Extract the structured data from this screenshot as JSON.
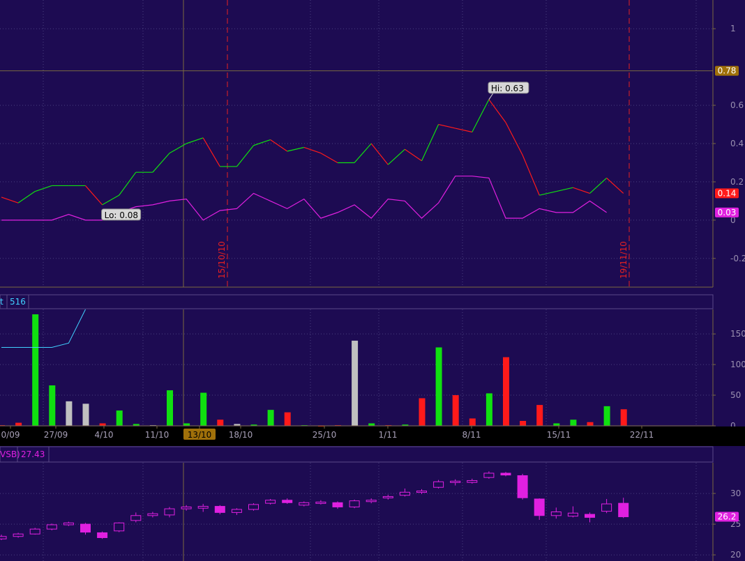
{
  "colors": {
    "background": "#1d0b52",
    "grid": "#4a4080",
    "axis": "#7a6a40",
    "up": "#10e010",
    "down": "#ff1a1a",
    "neutral": "#c0c0c0",
    "oscillator": "#e020e0",
    "cyan": "#40d0ff",
    "marker": "#e82020",
    "crosshair_badge": "#a0700a"
  },
  "chart_data": [
    {
      "type": "line",
      "panel": "top",
      "ylim": [
        -0.35,
        1.15
      ],
      "yticks": [
        "1",
        "0.6",
        "0.4",
        "0.2",
        "0",
        "-0.2"
      ],
      "ytick_values": [
        1,
        0.6,
        0.4,
        0.2,
        0,
        -0.2
      ],
      "crosshair": {
        "value": 0.78,
        "label": "0.78"
      },
      "series": [
        {
          "color": "red_green",
          "values": [
            0.12,
            0.09,
            0.15,
            0.18,
            0.18,
            0.18,
            0.08,
            0.13,
            0.25,
            0.25,
            0.35,
            0.4,
            0.43,
            0.28,
            0.28,
            0.39,
            0.42,
            0.36,
            0.38,
            0.35,
            0.3,
            0.3,
            0.4,
            0.29,
            0.37,
            0.31,
            0.5,
            0.48,
            0.46,
            0.63,
            0.51,
            0.34,
            0.13,
            0.15,
            0.17,
            0.14,
            0.22,
            0.14
          ],
          "last_label": "0.14"
        },
        {
          "color": "magenta",
          "values": [
            0.0,
            0.0,
            0.0,
            0.0,
            0.03,
            0.0,
            0.0,
            0.04,
            0.07,
            0.08,
            0.1,
            0.11,
            0.0,
            0.05,
            0.06,
            0.14,
            0.1,
            0.06,
            0.11,
            0.01,
            0.04,
            0.08,
            0.01,
            0.11,
            0.1,
            0.01,
            0.09,
            0.23,
            0.23,
            0.22,
            0.01,
            0.01,
            0.06,
            0.04,
            0.04,
            0.1,
            0.04
          ],
          "last_label": "0.03"
        }
      ],
      "annotations": [
        {
          "text": "Hi: 0.63"
        },
        {
          "text": "Lo: 0.08"
        }
      ],
      "markers": [
        "15/10/10",
        "19/11/10"
      ]
    },
    {
      "type": "bar",
      "panel": "volume",
      "header_left": "t",
      "header_value": "516",
      "ylim": [
        0,
        190
      ],
      "yticks": [
        "150",
        "100",
        "50",
        "0"
      ],
      "ytick_values": [
        150,
        100,
        50,
        0
      ],
      "xtick_labels": [
        "0/09",
        "27/09",
        "4/10",
        "11/10",
        "13/10",
        "18/10",
        "25/10",
        "1/11",
        "8/11",
        "15/11",
        "22/11"
      ],
      "highlighted_xtick": "13/10",
      "values": [
        1,
        5,
        182,
        66,
        40,
        36,
        4,
        25,
        3,
        1,
        58,
        4,
        54,
        10,
        3,
        2,
        26,
        22,
        1,
        0,
        1,
        139,
        4,
        1,
        2,
        45,
        128,
        50,
        12,
        53,
        112,
        8,
        34,
        4,
        10,
        6,
        32,
        27
      ],
      "bar_colors": [
        "down",
        "down",
        "up",
        "up",
        "neutral",
        "neutral",
        "down",
        "up",
        "up",
        "neutral",
        "up",
        "up",
        "up",
        "down",
        "neutral",
        "up",
        "up",
        "down",
        "up",
        "down",
        "down",
        "neutral",
        "up",
        "down",
        "up",
        "down",
        "up",
        "down",
        "down",
        "up",
        "down",
        "down",
        "down",
        "up",
        "up",
        "down",
        "up",
        "down"
      ],
      "line_values": [
        128,
        128,
        128,
        128,
        135,
        190
      ]
    },
    {
      "type": "candlestick",
      "panel": "price",
      "header_left": "VSB)",
      "header_value": "27.43",
      "ylim": [
        19,
        35
      ],
      "yticks": [
        "30",
        "25",
        "20"
      ],
      "ytick_values": [
        30,
        25,
        20
      ],
      "last_label": "26.2",
      "candles": [
        {
          "o": 22.6,
          "c": 23.0,
          "h": 23.3,
          "l": 22.4
        },
        {
          "o": 23.0,
          "c": 23.4,
          "h": 23.6,
          "l": 22.8
        },
        {
          "o": 23.4,
          "c": 24.2,
          "h": 24.4,
          "l": 23.3
        },
        {
          "o": 24.2,
          "c": 24.9,
          "h": 25.1,
          "l": 24.0
        },
        {
          "o": 24.9,
          "c": 25.2,
          "h": 25.4,
          "l": 24.7
        },
        {
          "o": 25.0,
          "c": 23.7,
          "h": 25.2,
          "l": 23.3
        },
        {
          "o": 23.6,
          "c": 22.8,
          "h": 23.8,
          "l": 22.6
        },
        {
          "o": 23.9,
          "c": 25.2,
          "h": 25.3,
          "l": 23.7
        },
        {
          "o": 25.6,
          "c": 26.4,
          "h": 26.9,
          "l": 25.3
        },
        {
          "o": 26.4,
          "c": 26.7,
          "h": 27.0,
          "l": 26.1
        },
        {
          "o": 26.5,
          "c": 27.5,
          "h": 27.8,
          "l": 26.1
        },
        {
          "o": 27.5,
          "c": 27.8,
          "h": 28.1,
          "l": 27.2
        },
        {
          "o": 27.6,
          "c": 27.9,
          "h": 28.3,
          "l": 27.0
        },
        {
          "o": 27.9,
          "c": 26.9,
          "h": 28.1,
          "l": 26.6
        },
        {
          "o": 26.9,
          "c": 27.4,
          "h": 27.6,
          "l": 26.5
        },
        {
          "o": 27.4,
          "c": 28.2,
          "h": 28.4,
          "l": 27.2
        },
        {
          "o": 28.4,
          "c": 28.9,
          "h": 29.1,
          "l": 28.2
        },
        {
          "o": 28.9,
          "c": 28.5,
          "h": 29.2,
          "l": 28.3
        },
        {
          "o": 28.1,
          "c": 28.5,
          "h": 28.7,
          "l": 27.9
        },
        {
          "o": 28.4,
          "c": 28.6,
          "h": 28.9,
          "l": 28.2
        },
        {
          "o": 28.5,
          "c": 27.8,
          "h": 28.7,
          "l": 27.5
        },
        {
          "o": 27.8,
          "c": 28.8,
          "h": 29.0,
          "l": 27.6
        },
        {
          "o": 28.7,
          "c": 28.9,
          "h": 29.2,
          "l": 28.4
        },
        {
          "o": 29.3,
          "c": 29.5,
          "h": 29.8,
          "l": 29.0
        },
        {
          "o": 29.7,
          "c": 30.2,
          "h": 30.8,
          "l": 29.5
        },
        {
          "o": 30.2,
          "c": 30.4,
          "h": 30.7,
          "l": 29.9
        },
        {
          "o": 31.0,
          "c": 31.9,
          "h": 32.2,
          "l": 30.8
        },
        {
          "o": 31.8,
          "c": 32.0,
          "h": 32.3,
          "l": 31.3
        },
        {
          "o": 31.8,
          "c": 32.1,
          "h": 32.4,
          "l": 31.6
        },
        {
          "o": 32.6,
          "c": 33.3,
          "h": 33.6,
          "l": 32.4
        },
        {
          "o": 33.3,
          "c": 33.0,
          "h": 33.5,
          "l": 32.8
        },
        {
          "o": 32.9,
          "c": 29.3,
          "h": 33.2,
          "l": 29.0
        },
        {
          "o": 29.1,
          "c": 26.4,
          "h": 29.2,
          "l": 25.7
        },
        {
          "o": 26.4,
          "c": 27.0,
          "h": 27.7,
          "l": 25.9
        },
        {
          "o": 26.3,
          "c": 26.8,
          "h": 27.9,
          "l": 26.1
        },
        {
          "o": 26.6,
          "c": 26.1,
          "h": 26.9,
          "l": 25.3
        },
        {
          "o": 27.1,
          "c": 28.3,
          "h": 29.1,
          "l": 26.8
        },
        {
          "o": 28.4,
          "c": 26.2,
          "h": 29.3,
          "l": 26.0
        }
      ]
    }
  ]
}
